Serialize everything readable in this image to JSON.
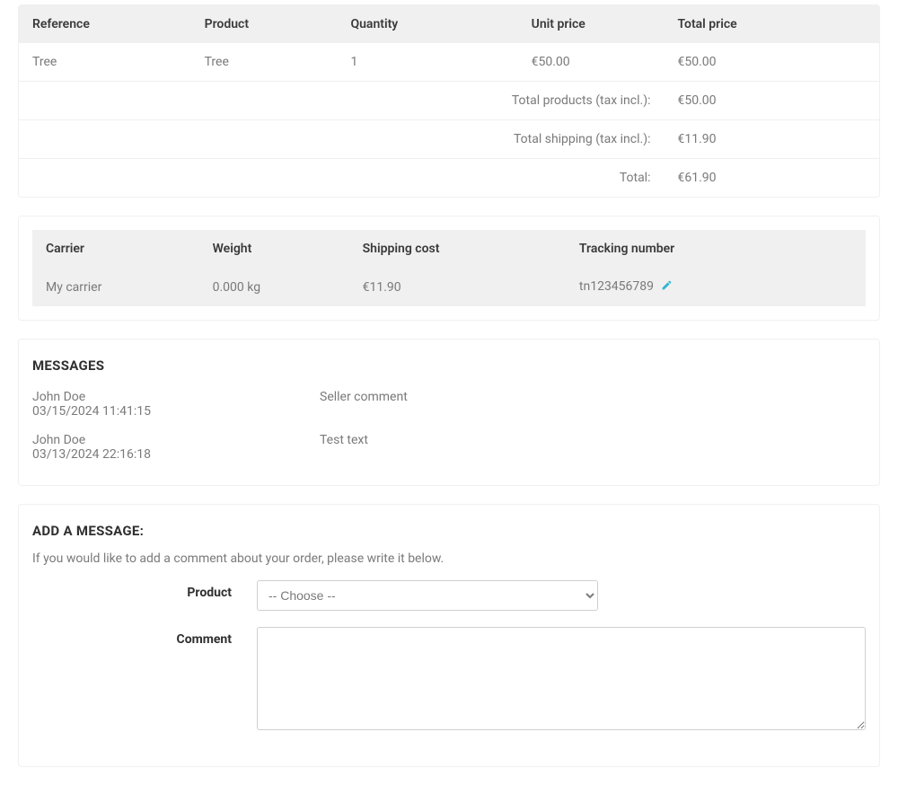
{
  "products_table": {
    "headers": {
      "reference": "Reference",
      "product": "Product",
      "quantity": "Quantity",
      "unit_price": "Unit price",
      "total_price": "Total price"
    },
    "rows": [
      {
        "reference": "Tree",
        "product": "Tree",
        "quantity": "1",
        "unit_price": "€50.00",
        "total_price": "€50.00"
      }
    ],
    "summary": [
      {
        "label": "Total products (tax incl.):",
        "value": "€50.00"
      },
      {
        "label": "Total shipping (tax incl.):",
        "value": "€11.90"
      },
      {
        "label": "Total:",
        "value": "€61.90"
      }
    ]
  },
  "shipping_table": {
    "headers": {
      "carrier": "Carrier",
      "weight": "Weight",
      "shipping_cost": "Shipping cost",
      "tracking": "Tracking number"
    },
    "rows": [
      {
        "carrier": "My carrier",
        "weight": "0.000 kg",
        "shipping_cost": "€11.90",
        "tracking": "tn123456789"
      }
    ]
  },
  "messages": {
    "title": "MESSAGES",
    "items": [
      {
        "name": "John Doe",
        "timestamp": "03/15/2024 11:41:15",
        "text": "Seller comment"
      },
      {
        "name": "John Doe",
        "timestamp": "03/13/2024 22:16:18",
        "text": "Test text"
      }
    ]
  },
  "add_message": {
    "title": "ADD A MESSAGE:",
    "hint": "If you would like to add a comment about your order, please write it below.",
    "product_label": "Product",
    "product_placeholder": "-- Choose --",
    "comment_label": "Comment"
  }
}
